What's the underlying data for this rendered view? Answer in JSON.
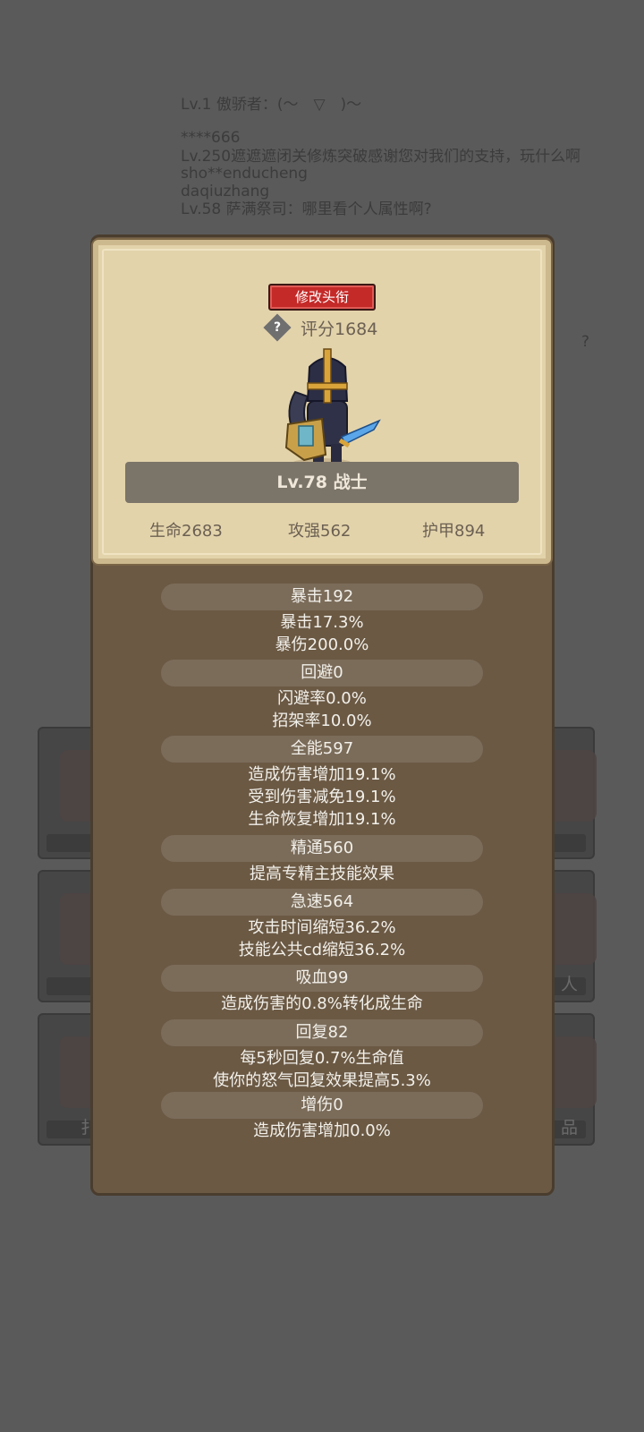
{
  "background": {
    "chat_lines": [
      "Lv.1 傲骄者：(～￣▽￣)～",
      "****666",
      "Lv.250遮遮遮闭关修炼突破感谢您对我们的支持，玩什么啊",
      "sho**enducheng",
      "daqiuzhang",
      "Lv.58 萨满祭司：哪里看个人属性啊?",
      "?"
    ],
    "slot_labels": [
      "人",
      "扌",
      "品"
    ]
  },
  "card": {
    "title_button": "修改头衔",
    "help_symbol": "?",
    "score": "评分1684",
    "level_class": "Lv.78 战士",
    "stats": {
      "hp": "生命2683",
      "attack": "攻强562",
      "armor": "护甲894"
    }
  },
  "attributes": [
    {
      "header": "暴击192",
      "lines": [
        "暴击17.3%",
        "暴伤200.0%"
      ]
    },
    {
      "header": "回避0",
      "lines": [
        "闪避率0.0%",
        "招架率10.0%"
      ]
    },
    {
      "header": "全能597",
      "lines": [
        "造成伤害增加19.1%",
        "受到伤害减免19.1%",
        "生命恢复增加19.1%"
      ]
    },
    {
      "header": "精通560",
      "lines": [
        "提高专精主技能效果"
      ]
    },
    {
      "header": "急速564",
      "lines": [
        "攻击时间缩短36.2%",
        "技能公共cd缩短36.2%"
      ]
    },
    {
      "header": "吸血99",
      "lines": [
        "造成伤害的0.8%转化成生命"
      ]
    },
    {
      "header": "回复82",
      "lines": [
        "每5秒回复0.7%生命值",
        "使你的怒气回复效果提高5.3%"
      ]
    },
    {
      "header": "增伤0",
      "lines": [
        "造成伤害增加0.0%"
      ]
    }
  ],
  "colors": {
    "overlay": "#5a5a5a",
    "panel": "#6b5944",
    "card": "#e3d3ab",
    "title_button": "#c42a28"
  }
}
